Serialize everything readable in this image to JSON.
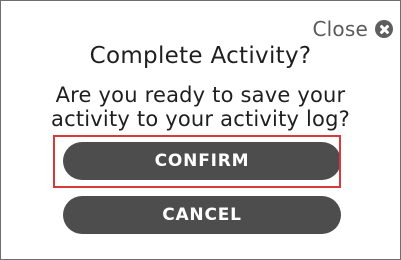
{
  "dialog": {
    "close_label": "Close",
    "close_icon": "close-circle-icon",
    "title": "Complete Activity?",
    "message_line1": "Are you ready to save your",
    "message_line2": "activity to your activity log?",
    "confirm_label": "CONFIRM",
    "cancel_label": "CANCEL"
  },
  "colors": {
    "button_bg": "#4d4d4d",
    "button_text": "#ffffff",
    "highlight": "#d63b3b",
    "text": "#1f1f1f",
    "muted": "#5b5b5b"
  }
}
